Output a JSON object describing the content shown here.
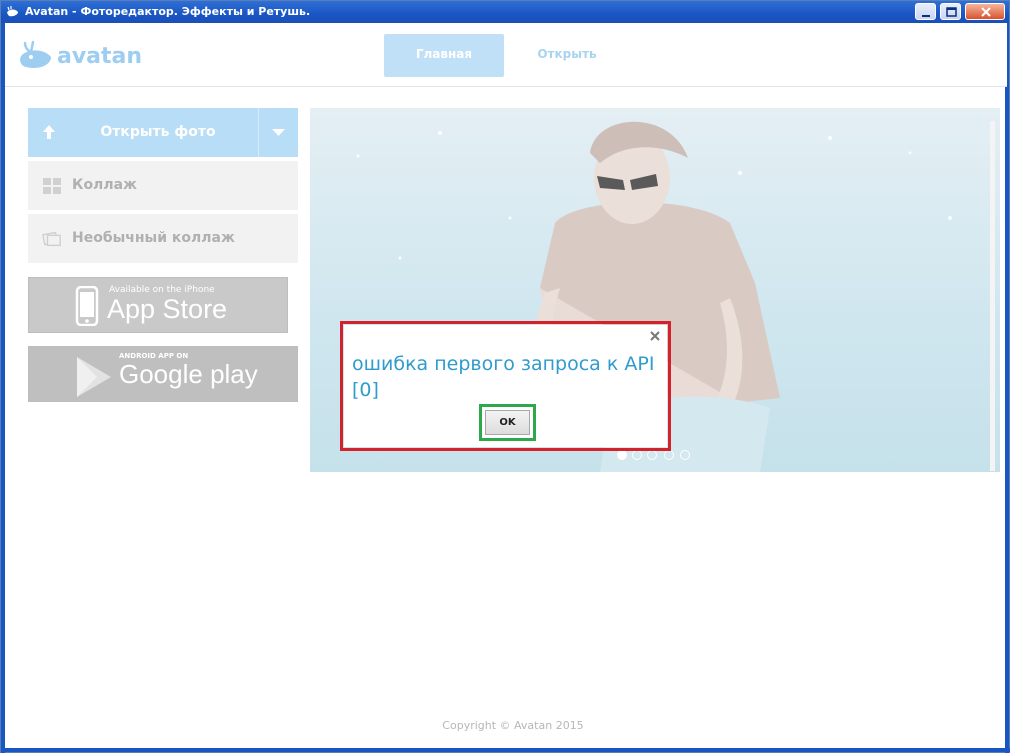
{
  "window": {
    "title": "Avatan - Фоторедактор. Эффекты и Ретушь.",
    "titlebar_color": "#1a56c3"
  },
  "header": {
    "logo_text": "avatan",
    "tabs": [
      {
        "label": "Главная",
        "active": true
      },
      {
        "label": "Открыть",
        "active": false
      }
    ]
  },
  "sidebar": {
    "open_photo_label": "Открыть фото",
    "items": [
      {
        "label": "Коллаж",
        "icon": "grid-icon"
      },
      {
        "label": "Необычный коллаж",
        "icon": "photos-icon"
      }
    ],
    "appstore": {
      "small": "Available on the iPhone",
      "big": "App Store"
    },
    "googleplay": {
      "small": "ANDROID APP ON",
      "big": "Google play"
    }
  },
  "carousel": {
    "slide_count": 5,
    "active_index": 0
  },
  "dialog": {
    "message_line1": "ошибка первого запроса к API",
    "message_line2": "[0]",
    "ok_label": "OK"
  },
  "footer": {
    "copyright": "Copyright © Avatan 2015"
  }
}
